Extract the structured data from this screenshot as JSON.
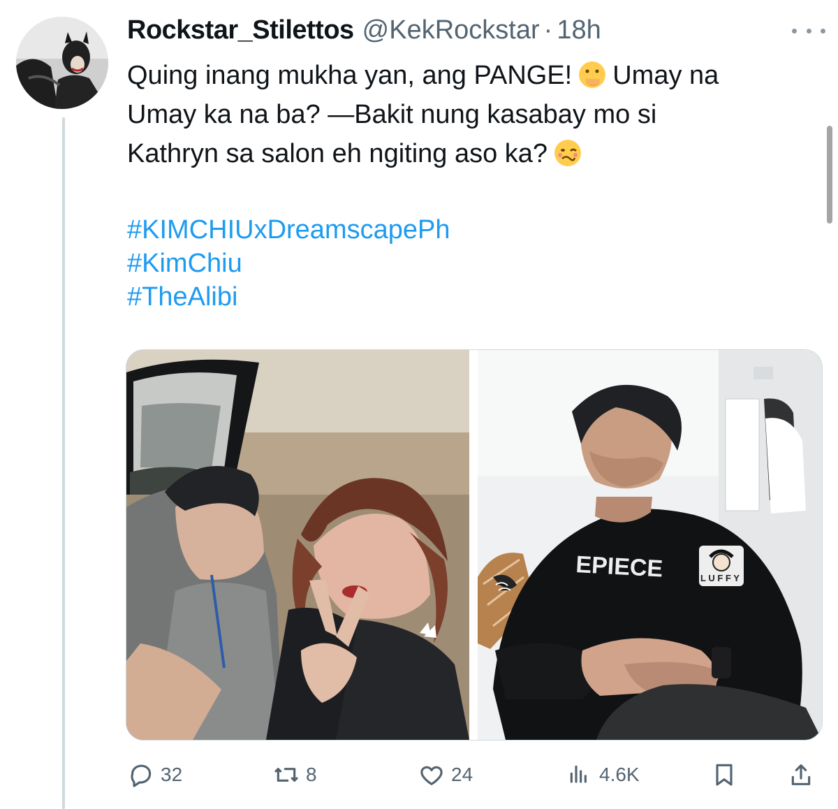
{
  "tweet": {
    "display_name": "Rockstar_Stilettos",
    "handle": "@KekRockstar",
    "separator": "·",
    "time": "18h",
    "text_line1_a": "Quing inang mukha yan, ang PANGE!",
    "text_line1_b": "Umay na",
    "text_line2": "Umay ka na ba? —Bakit nung kasabay mo si",
    "text_line3": "Kathryn sa salon eh ngiting aso ka?",
    "hashtags": [
      "#KIMCHIUxDreamscapePh",
      "#KimChiu",
      "#TheAlibi"
    ],
    "printed_text": {
      "shirt_left": "EPIECE"
    }
  },
  "actions": {
    "reply_count": "32",
    "retweet_count": "8",
    "like_count": "24",
    "views_count": "4.6K"
  },
  "icons": {
    "more": "more-options-icon",
    "reply": "reply-icon",
    "retweet": "retweet-icon",
    "like": "heart-icon",
    "views": "views-chart-icon",
    "bookmark": "bookmark-icon",
    "share": "share-icon"
  },
  "colors": {
    "link": "#1d9bf0",
    "secondary_text": "#536471",
    "border": "#cfd9de"
  }
}
